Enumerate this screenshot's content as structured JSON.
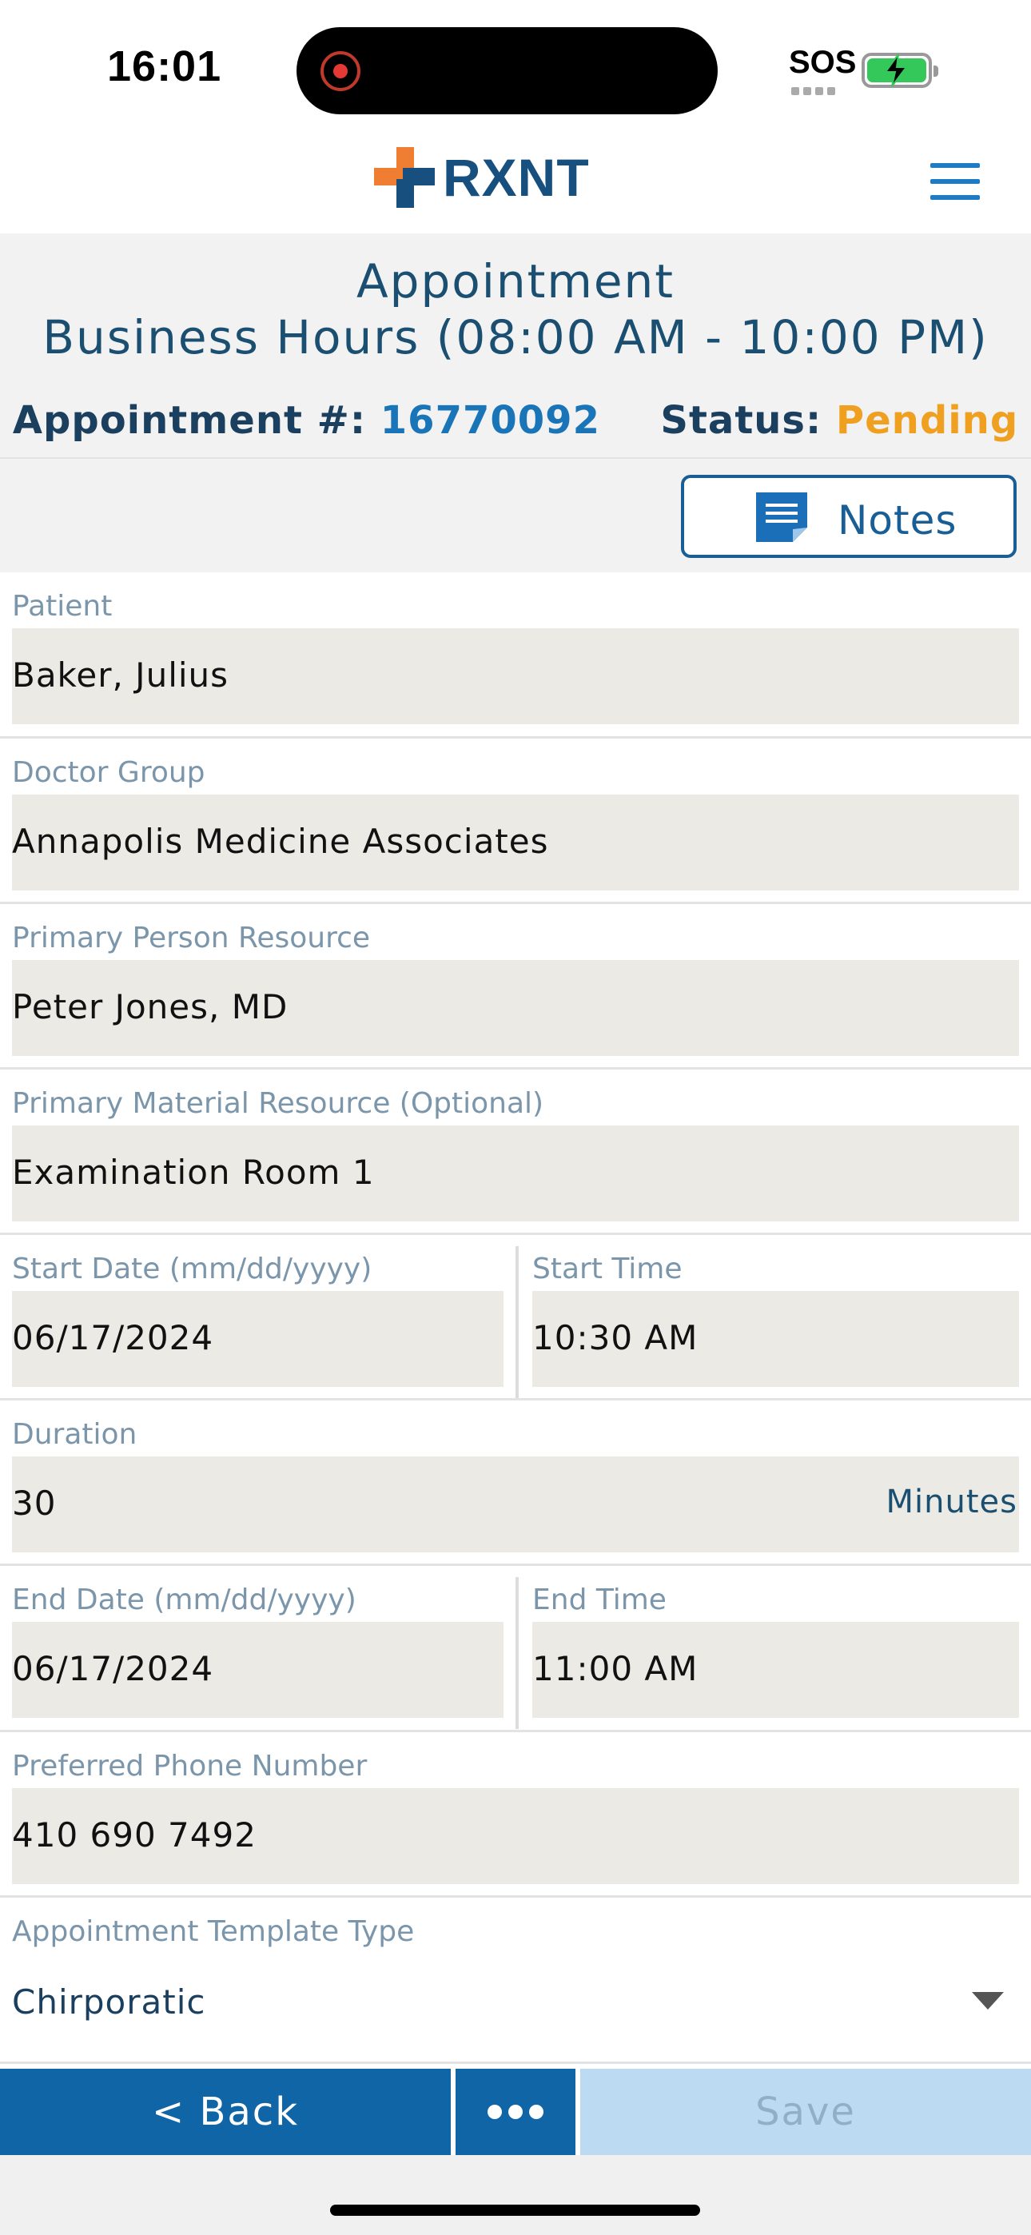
{
  "status_bar": {
    "time": "16:01",
    "sos": "SOS",
    "battery_color": "#34c759"
  },
  "app": {
    "logo_text": "RXNT",
    "menu_icon": "hamburger-menu-icon",
    "brand_colors": {
      "orange": "#ef7d32",
      "navy": "#17507e",
      "blue": "#1e7bc4"
    }
  },
  "header": {
    "title": "Appointment",
    "business_hours": "Business Hours (08:00 AM - 10:00 PM)",
    "appointment_label": "Appointment #:",
    "appointment_number": "16770092",
    "status_label": "Status:",
    "status_value": "Pending",
    "status_color": "#f0a020"
  },
  "notes_button": {
    "label": "Notes",
    "icon": "notes-icon"
  },
  "form": {
    "patient": {
      "label": "Patient",
      "value": "Baker, Julius"
    },
    "doctor_group": {
      "label": "Doctor Group",
      "value": "Annapolis Medicine Associates"
    },
    "primary_person_resource": {
      "label": "Primary Person Resource",
      "value": "Peter Jones, MD"
    },
    "primary_material_resource": {
      "label": "Primary Material Resource (Optional)",
      "value": "Examination Room 1"
    },
    "start_date": {
      "label": "Start Date (mm/dd/yyyy)",
      "value": "06/17/2024"
    },
    "start_time": {
      "label": "Start Time",
      "value": "10:30 AM"
    },
    "duration": {
      "label": "Duration",
      "value": "30",
      "unit": "Minutes"
    },
    "end_date": {
      "label": "End Date (mm/dd/yyyy)",
      "value": "06/17/2024"
    },
    "end_time": {
      "label": "End Time",
      "value": "11:00 AM"
    },
    "preferred_phone": {
      "label": "Preferred Phone Number",
      "value": "410 690 7492"
    },
    "template_type": {
      "label": "Appointment Template Type",
      "value": "Chirporatic"
    }
  },
  "actions": {
    "back_label": "< Back",
    "more_icon": "more-dots-icon",
    "save_label": "Save"
  }
}
